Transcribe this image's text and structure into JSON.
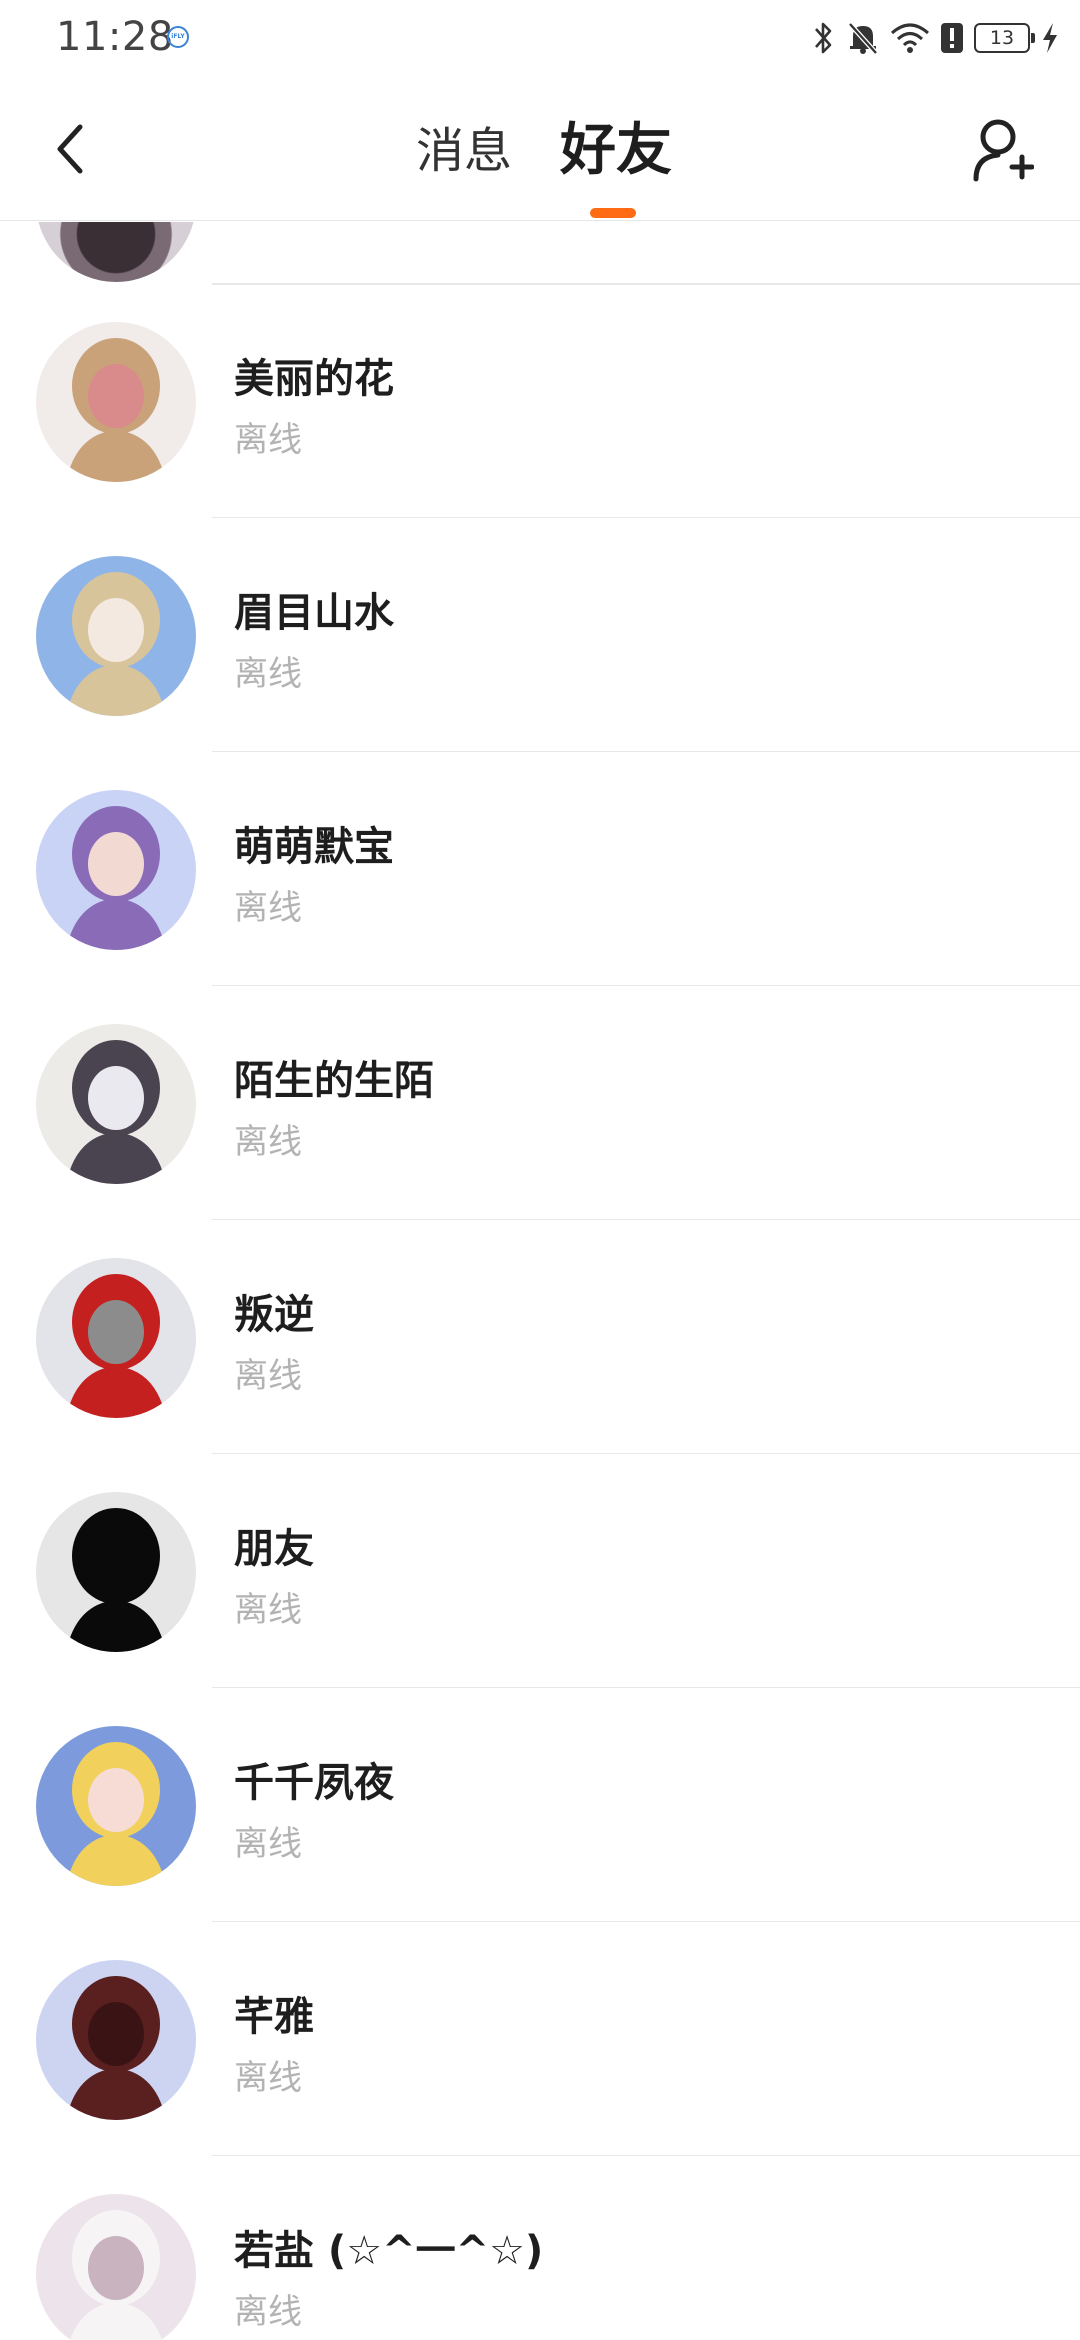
{
  "status_bar": {
    "time": "11:28",
    "carrier_badge": "iFLY",
    "battery": "13",
    "icons": [
      "bluetooth-icon",
      "mute-bell-icon",
      "wifi-icon",
      "alert-icon",
      "battery-icon",
      "charging-icon"
    ]
  },
  "nav": {
    "tab_messages": "消息",
    "tab_friends": "好友",
    "accent_color": "#ff6a14"
  },
  "friends": [
    {
      "name": "美丽的花",
      "status": "离线",
      "avatar_colors": [
        "#f1ebe9",
        "#c9a27a",
        "#d98a8a"
      ]
    },
    {
      "name": "眉目山水",
      "status": "离线",
      "avatar_colors": [
        "#8fb5e8",
        "#d8c49a",
        "#f3e9e0"
      ]
    },
    {
      "name": "萌萌默宝",
      "status": "离线",
      "avatar_colors": [
        "#c9d3f5",
        "#8a6bb8",
        "#f2d9d2"
      ]
    },
    {
      "name": "陌生的生陌",
      "status": "离线",
      "avatar_colors": [
        "#ecebe8",
        "#4a4450",
        "#e9e9ef"
      ]
    },
    {
      "name": "叛逆",
      "status": "离线",
      "avatar_colors": [
        "#e3e3ea",
        "#c42020",
        "#8c8c8c"
      ]
    },
    {
      "name": "朋友",
      "status": "离线",
      "avatar_colors": [
        "#e6e6e6",
        "#0a0a0a",
        "#0a0a0a"
      ]
    },
    {
      "name": "千千夙夜",
      "status": "离线",
      "avatar_colors": [
        "#7d9bdc",
        "#f1d15b",
        "#f6dcd5"
      ]
    },
    {
      "name": "芊雅",
      "status": "离线",
      "avatar_colors": [
        "#cdd4f2",
        "#5a1f1f",
        "#3a1414"
      ]
    },
    {
      "name": "若盐 (☆^一^☆)",
      "status": "离线",
      "avatar_colors": [
        "#ede3ea",
        "#f7f4f6",
        "#c9b3bf"
      ]
    }
  ]
}
